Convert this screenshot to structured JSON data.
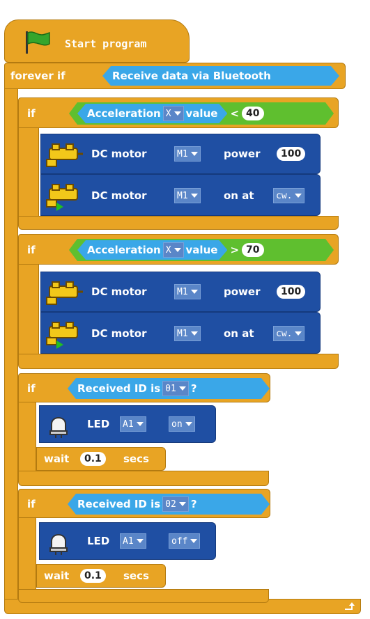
{
  "start_block": {
    "label": "Start program"
  },
  "forever": {
    "label": "forever if",
    "condition": "Receive data via Bluetooth"
  },
  "if_blocks": [
    {
      "keyword": "if",
      "condition": {
        "label": "Acceleration",
        "axis": "X",
        "suffix": "value",
        "op": "<",
        "value": "40"
      },
      "body": [
        {
          "label": "DC motor",
          "port": "M1",
          "param_label": "power",
          "param_value": "100"
        },
        {
          "label": "DC motor",
          "port": "M1",
          "param_label": "on at",
          "param_value": "cw."
        }
      ]
    },
    {
      "keyword": "if",
      "condition": {
        "label": "Acceleration",
        "axis": "X",
        "suffix": "value",
        "op": ">",
        "value": "70"
      },
      "body": [
        {
          "label": "DC motor",
          "port": "M1",
          "param_label": "power",
          "param_value": "100"
        },
        {
          "label": "DC motor",
          "port": "M1",
          "param_label": "on at",
          "param_value": "cw."
        }
      ]
    },
    {
      "keyword": "if",
      "condition": {
        "label": "Received ID is",
        "value": "01",
        "suffix": "?"
      },
      "led": {
        "label": "LED",
        "port": "A1",
        "state": "on"
      },
      "wait": {
        "label": "wait",
        "value": "0.1",
        "unit": "secs"
      }
    },
    {
      "keyword": "if",
      "condition": {
        "label": "Received ID is",
        "value": "02",
        "suffix": "?"
      },
      "led": {
        "label": "LED",
        "port": "A1",
        "state": "off"
      },
      "wait": {
        "label": "wait",
        "value": "0.1",
        "unit": "secs"
      }
    }
  ],
  "icons": [
    "green-flag-icon",
    "dc-motor-icon",
    "led-icon",
    "loop-arrow-icon"
  ],
  "colors": {
    "control": "#e8a424",
    "motor": "#1f4fa3",
    "sensor": "#3aa7e8",
    "operator": "#5fbf2f"
  }
}
